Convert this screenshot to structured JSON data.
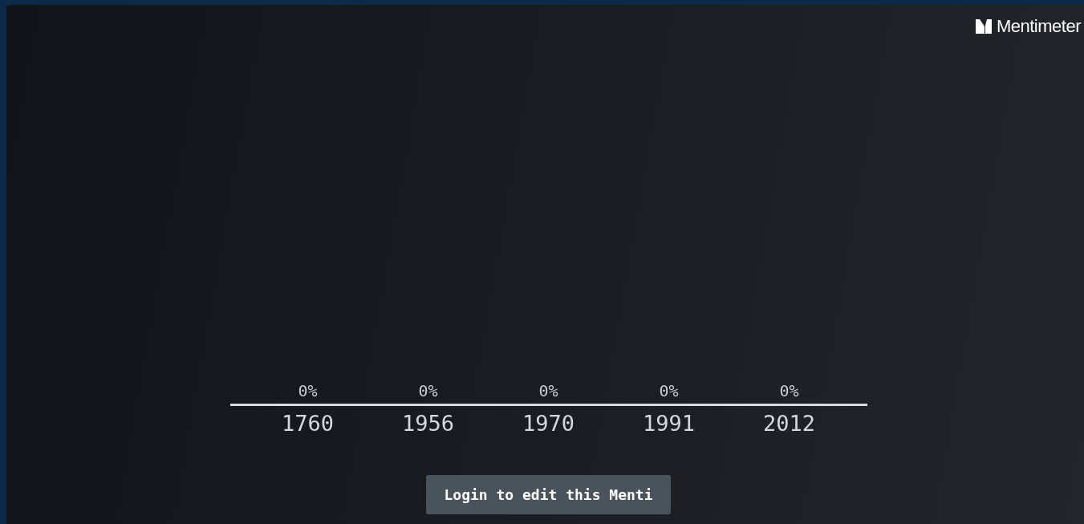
{
  "brand": {
    "name": "Mentimeter"
  },
  "results": [
    {
      "percentage": "0%",
      "label": "1760"
    },
    {
      "percentage": "0%",
      "label": "1956"
    },
    {
      "percentage": "0%",
      "label": "1970"
    },
    {
      "percentage": "0%",
      "label": "1991"
    },
    {
      "percentage": "0%",
      "label": "2012"
    }
  ],
  "login_button": {
    "label": "Login to edit this Menti"
  }
}
